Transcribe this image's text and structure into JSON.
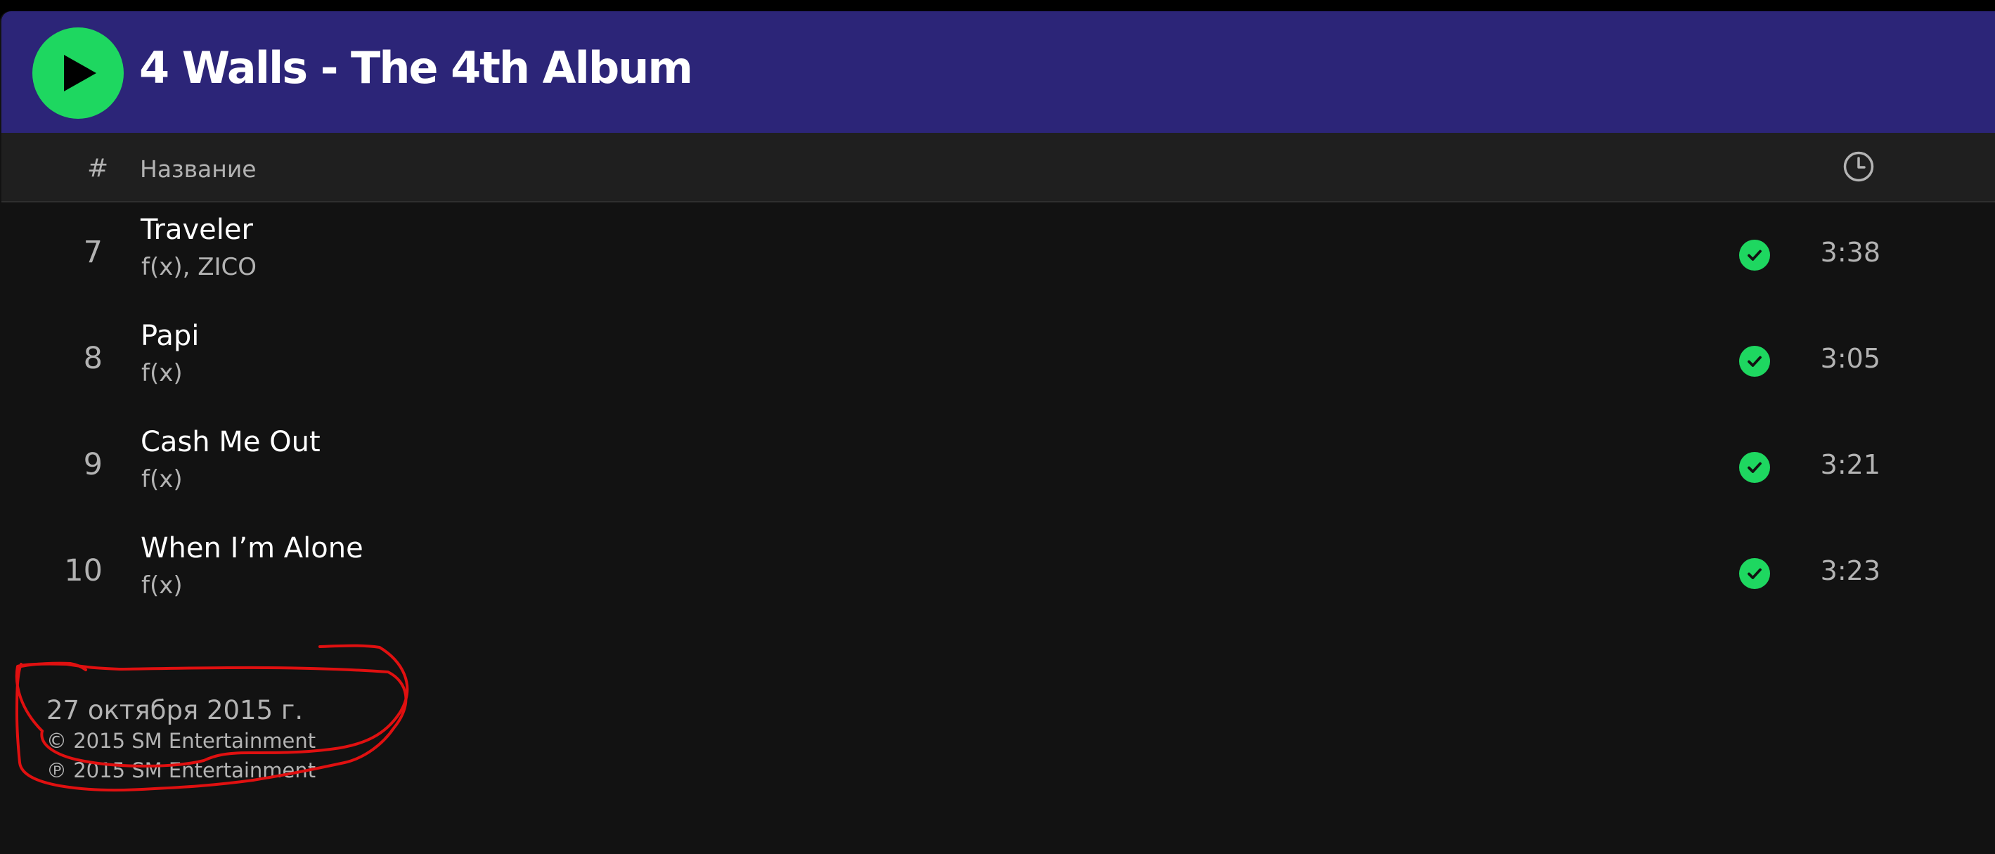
{
  "album": {
    "title": "4 Walls - The 4th Album",
    "header_color": "#2c2578"
  },
  "list_header": {
    "number_label": "#",
    "title_label": "Название",
    "duration_icon": "clock-icon"
  },
  "tracks": [
    {
      "number": "7",
      "title": "Traveler",
      "artists": "f(x), ZICO",
      "duration": "3:38",
      "saved": true
    },
    {
      "number": "8",
      "title": "Papi",
      "artists": "f(x)",
      "duration": "3:05",
      "saved": true
    },
    {
      "number": "9",
      "title": "Cash Me Out",
      "artists": "f(x)",
      "duration": "3:21",
      "saved": true
    },
    {
      "number": "10",
      "title": "When I’m Alone",
      "artists": "f(x)",
      "duration": "3:23",
      "saved": true
    }
  ],
  "footer": {
    "release_date": "27 октября 2015 г.",
    "copyright": "© 2015 SM Entertainment",
    "phonogram": "℗ 2015 SM Entertainment"
  },
  "colors": {
    "accent": "#1ed760",
    "background": "#121212",
    "annotation": "#e01010"
  },
  "icons": {
    "play": "play-icon",
    "saved": "check-circle-icon",
    "duration": "clock-icon"
  }
}
